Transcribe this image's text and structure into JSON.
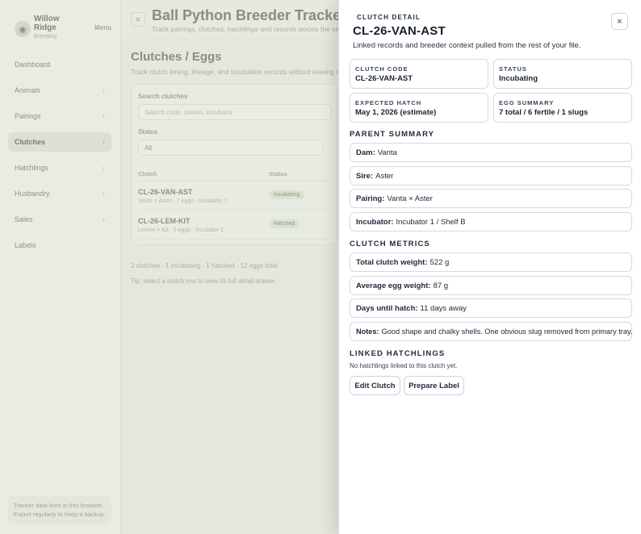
{
  "app": {
    "brand_name": "Willow Ridge",
    "brand_sub": "Breeding",
    "brand_menu": "Menu",
    "title": "Ball Python Breeder Tracker",
    "subtitle": "Track pairings, clutches, hatchlings and records across the season.",
    "page_title": "Clutches / Eggs",
    "page_subtitle": "Track clutch timing, lineage, and incubation records without leaving the workspace.",
    "nav": [
      {
        "label": "Dashboard",
        "caret": ""
      },
      {
        "label": "Animals",
        "caret": "›"
      },
      {
        "label": "Pairings",
        "caret": "›"
      },
      {
        "label": "Clutches",
        "caret": "›"
      },
      {
        "label": "Hatchlings",
        "caret": "›"
      },
      {
        "label": "Husbandry",
        "caret": "›"
      },
      {
        "label": "Sales",
        "caret": "›"
      },
      {
        "label": "Labels",
        "caret": ""
      }
    ],
    "side_note": "Tracker data lives in this browser. Export regularly to keep a backup.",
    "filters": {
      "search_label": "Search clutches",
      "search_placeholder": "Search code, parent, incubator",
      "status_label": "Status",
      "status_value": "All"
    },
    "table": {
      "col_clutch": "Clutch",
      "col_status": "Status",
      "rows": [
        {
          "code": "CL-26-VAN-AST",
          "meta": "Vanta × Aster · 7 eggs · Incubator 1",
          "badge": "Incubating"
        },
        {
          "code": "CL-26-LEM-KIT",
          "meta": "Lemon × Kit · 5 eggs · Incubator 2",
          "badge": "Hatched"
        }
      ]
    },
    "foot_1": "2 clutches · 1 incubating · 1 hatched · 12 eggs total",
    "foot_2": "Tip: select a clutch row to view its full detail drawer."
  },
  "drawer": {
    "eyebrow": "Clutch Detail",
    "title": "CL-26-VAN-AST",
    "subtitle": "Linked records and breeder context pulled from the rest of your file.",
    "close_glyph": "×",
    "cards": {
      "clutch_code_label": "Clutch Code",
      "clutch_code_value": "CL-26-VAN-AST",
      "status_label": "Status",
      "status_value": "Incubating",
      "expected_hatch_label": "Expected Hatch",
      "expected_hatch_value": "May 1, 2026 (estimate)",
      "egg_summary_label": "Egg Summary",
      "egg_summary_value": "7 total / 6 fertile / 1 slugs"
    },
    "parent_summary_heading": "Parent Summary",
    "parent": {
      "dam_key": "Dam:",
      "dam_value": "Vanta",
      "sire_key": "Sire:",
      "sire_value": "Aster",
      "pairing_key": "Pairing:",
      "pairing_value": "Vanta × Aster",
      "incubator_key": "Incubator:",
      "incubator_value": "Incubator 1 / Shelf B"
    },
    "metrics_heading": "Clutch Metrics",
    "metrics": {
      "total_weight_key": "Total clutch weight:",
      "total_weight_value": "522 g",
      "avg_weight_key": "Average egg weight:",
      "avg_weight_value": "87 g",
      "days_key": "Days until hatch:",
      "days_value": "11 days away",
      "notes_key": "Notes:",
      "notes_value": "Good shape and chalky shells. One obvious slug removed from primary tray."
    },
    "hatchlings_heading": "Linked Hatchlings",
    "hatchlings_empty": "No hatchlings linked to this clutch yet.",
    "edit_button": "Edit Clutch",
    "label_button": "Prepare Label"
  }
}
